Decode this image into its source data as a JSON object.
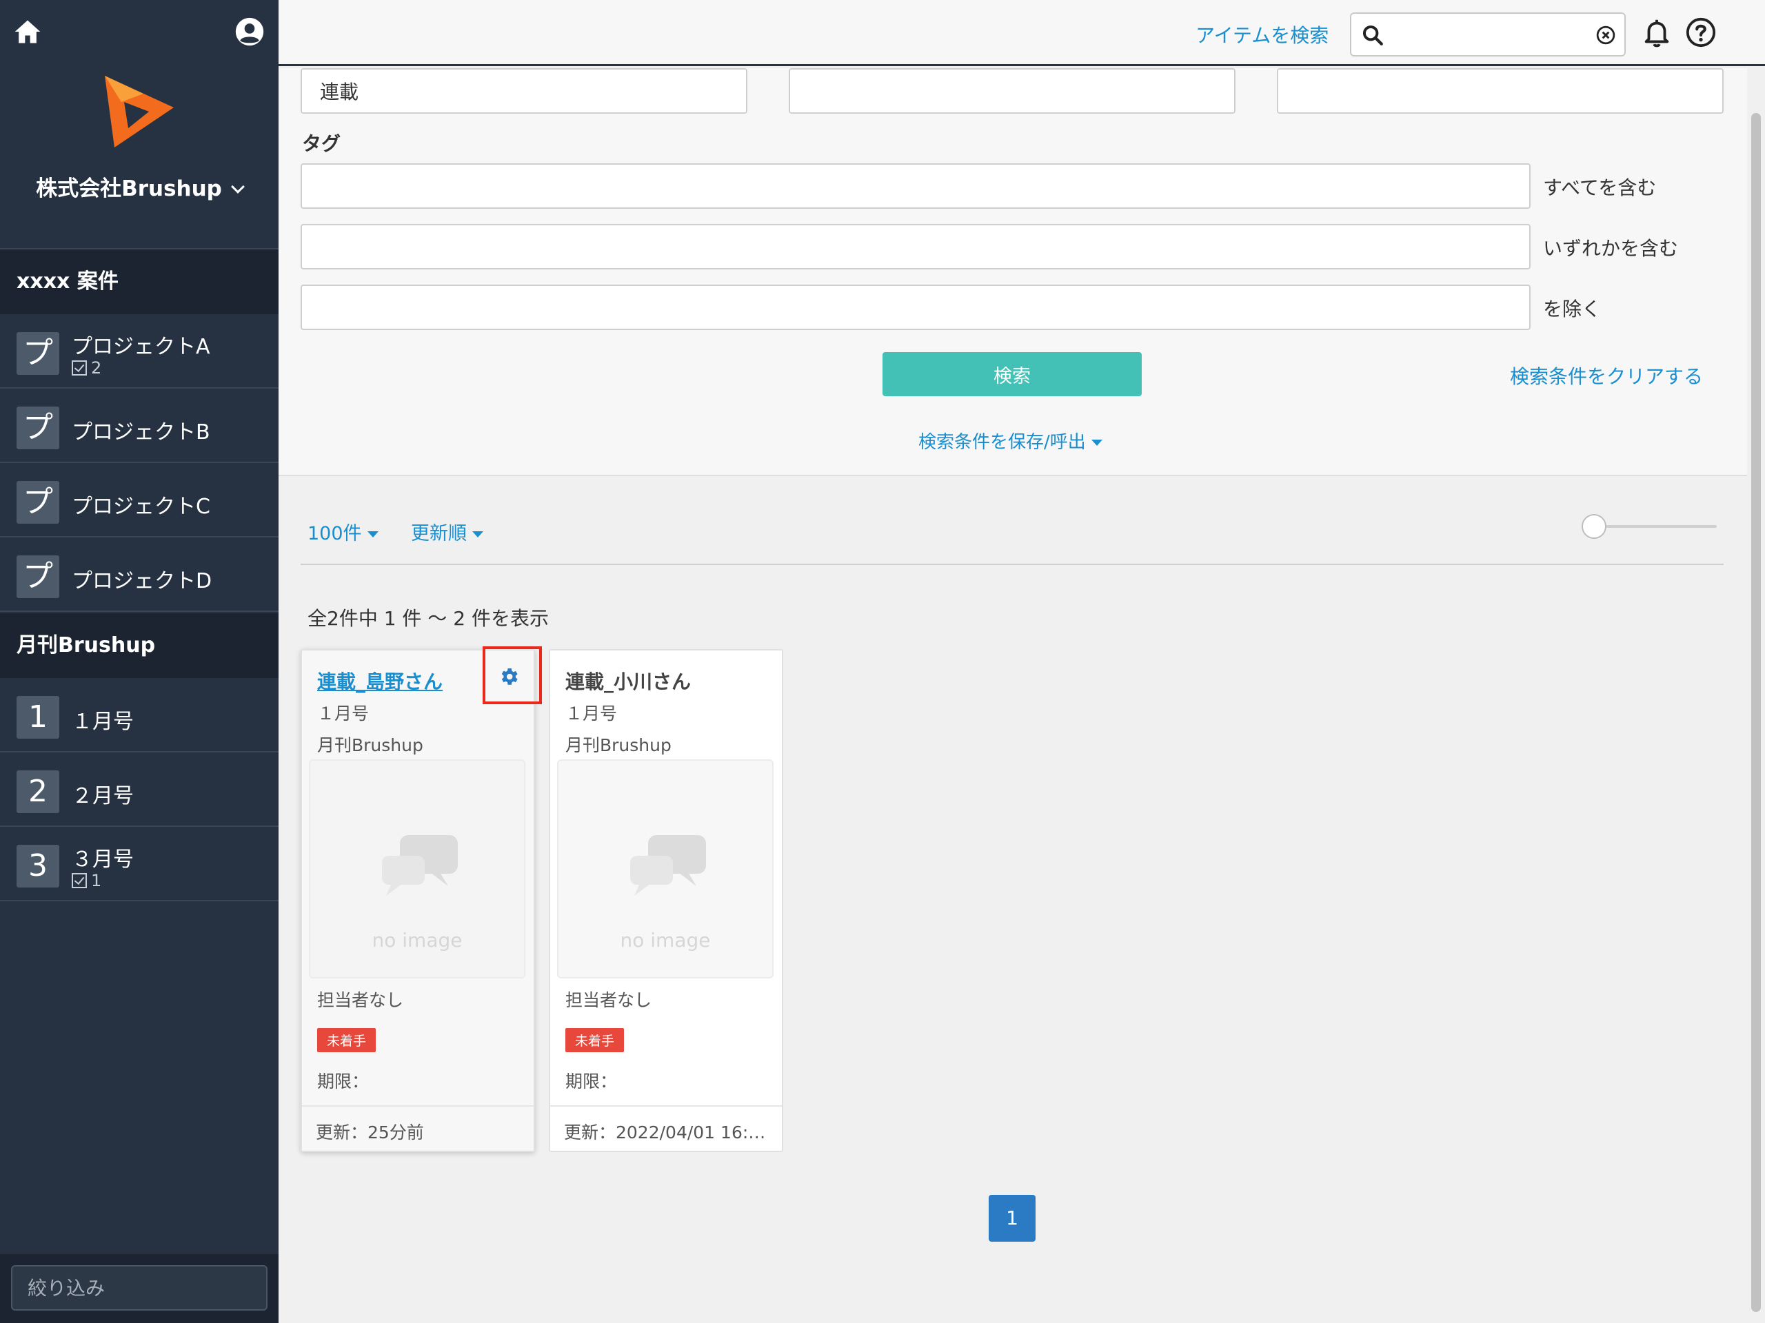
{
  "sidebar": {
    "company": "株式会社Brushup",
    "groups": [
      {
        "name": "xxxx 案件",
        "items": [
          {
            "tile": "プ",
            "label": "プロジェクトA",
            "task_count": "2"
          },
          {
            "tile": "プ",
            "label": "プロジェクトB"
          },
          {
            "tile": "プ",
            "label": "プロジェクトC"
          },
          {
            "tile": "プ",
            "label": "プロジェクトD"
          }
        ]
      },
      {
        "name": "月刊Brushup",
        "items": [
          {
            "tile": "1",
            "label": "１月号"
          },
          {
            "tile": "2",
            "label": "２月号"
          },
          {
            "tile": "3",
            "label": "３月号",
            "task_count": "1"
          }
        ]
      }
    ],
    "filter_placeholder": "絞り込み"
  },
  "header": {
    "search_label": "アイテムを検索",
    "search_value": ""
  },
  "search_form": {
    "field1_value": "連載",
    "field2_value": "",
    "field3_value": "",
    "tag_label": "タグ",
    "tag_rows": [
      {
        "value": "",
        "op": "すべてを含む"
      },
      {
        "value": "",
        "op": "いずれかを含む"
      },
      {
        "value": "",
        "op": "を除く"
      }
    ],
    "search_button": "検索",
    "clear_link": "検索条件をクリアする",
    "save_link": "検索条件を保存/呼出"
  },
  "results": {
    "page_size": "100件",
    "sort": "更新順",
    "zoom_level": 0,
    "count_text": "全2件中 1 件 〜 2 件を表示",
    "cards": [
      {
        "title": "連載_島野さん",
        "issue": "１月号",
        "project": "月刊Brushup",
        "thumb_text": "no image",
        "assignee": "担当者なし",
        "status": "未着手",
        "due": "期限：",
        "updated": "更新：25分前"
      },
      {
        "title": "連載_小川さん",
        "issue": "１月号",
        "project": "月刊Brushup",
        "thumb_text": "no image",
        "assignee": "担当者なし",
        "status": "未着手",
        "due": "期限：",
        "updated": "更新：2022/04/01 16:…"
      }
    ],
    "current_page": "1"
  },
  "colors": {
    "sidebar_bg": "#263241",
    "accent_link": "#1a8fcf",
    "search_button": "#44c1b6",
    "status_badge": "#e8483c",
    "page_button": "#2a7ac4",
    "highlight": "#e8291c"
  }
}
